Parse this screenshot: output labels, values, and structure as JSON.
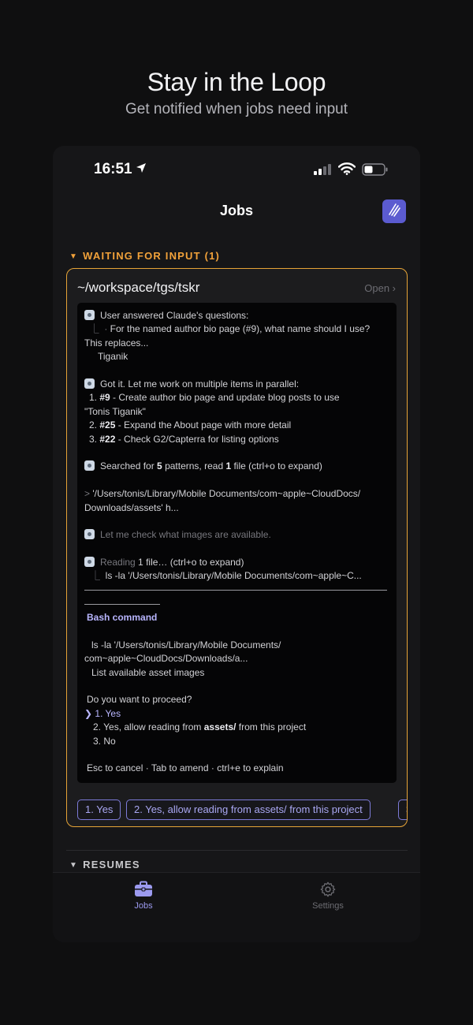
{
  "hero": {
    "title": "Stay in the Loop",
    "subtitle": "Get notified when jobs need input"
  },
  "status_bar": {
    "time": "16:51",
    "icons": [
      "location-arrow-icon",
      "signal-icon",
      "wifi-icon",
      "battery-icon"
    ]
  },
  "nav": {
    "title": "Jobs",
    "app_button_icon": "claw-marks-icon"
  },
  "sections": {
    "waiting": "WAITING FOR INPUT (1)",
    "resumes": "RESUMES"
  },
  "job": {
    "path": "~/workspace/tgs/tskr",
    "open_label": "Open ›",
    "terminal": {
      "l1": "User answered Claude's questions:",
      "l2a": "  ⎿  · ",
      "l2b": "For the named author bio page (#9), what name should I use?",
      "l3": "This replaces...",
      "l4": "Tiganik",
      "l5": "Got it. Let me work on multiple items in parallel:",
      "l6_num": "1. ",
      "l6_ref": "#9",
      "l6_text": " - Create author bio page and update blog posts to use",
      "l7": "\"Tonis Tiganik\"",
      "l8_num": "2. ",
      "l8_ref": "#25",
      "l8_text": " - Expand the About page with more detail",
      "l9_num": "3. ",
      "l9_ref": "#22",
      "l9_text": " - Check G2/Capterra for listing options",
      "l10_a": "Searched for ",
      "l10_b": "5",
      "l10_c": " patterns, read ",
      "l10_d": "1",
      "l10_e": " file (ctrl+o to expand)",
      "l11_prefix": "> ",
      "l11": "'/Users/tonis/Library/Mobile Documents/com~apple~CloudDocs/",
      "l12": "Downloads/assets' h...",
      "l13": "Let me check what images are available.",
      "l14_a": "Reading ",
      "l14_b": "1",
      "l14_c": " file… (ctrl+o to expand)",
      "l15_prefix": "⎿  ",
      "l15": "ls -la '/Users/tonis/Library/Mobile Documents/com~apple~C...",
      "bash_title": "Bash command",
      "l16": "ls -la '/Users/tonis/Library/Mobile Documents/",
      "l17": "com~apple~CloudDocs/Downloads/a...",
      "l18": "List available asset images",
      "l19": "Do you want to proceed?",
      "opt1_prefix": "❯ ",
      "opt1": "1. Yes",
      "opt2_a": "2. Yes, allow reading from ",
      "opt2_b": "assets/",
      "opt2_c": " from this project",
      "opt3": "3. No",
      "footer": "Esc to cancel · Tab to amend · ctrl+e to explain"
    },
    "choices": [
      "1. Yes",
      "2. Yes, allow reading from assets/ from this project",
      "3. No"
    ]
  },
  "tabs": {
    "jobs": "Jobs",
    "settings": "Settings"
  },
  "colors": {
    "accent": "#9c9af0",
    "warning": "#f2a23a",
    "background": "#0f0f10"
  }
}
